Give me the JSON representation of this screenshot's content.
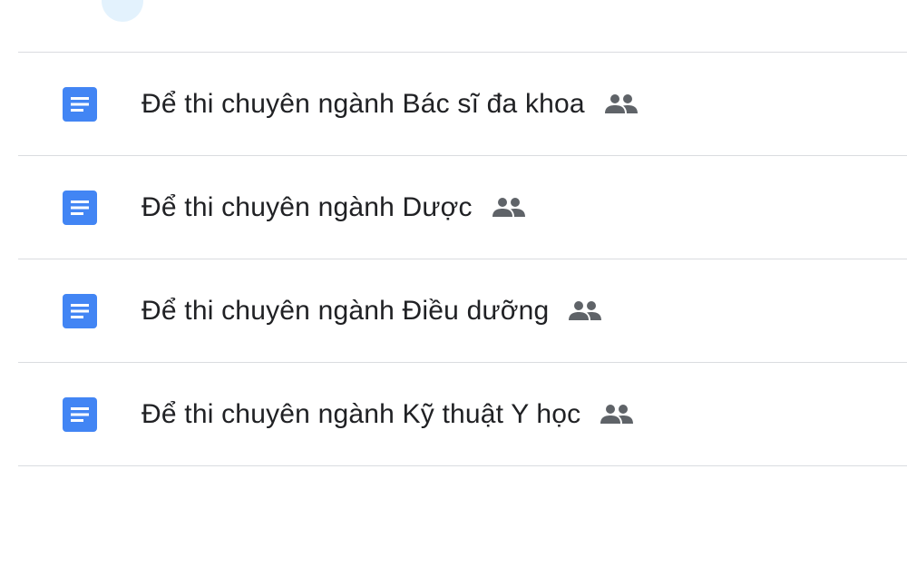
{
  "colors": {
    "doc_icon": "#4285f4",
    "shared_icon": "#5f6368",
    "text": "#202124",
    "divider": "#dadce0"
  },
  "file_list": {
    "items": [
      {
        "name": "Để thi chuyên ngành Bác sĩ đa khoa",
        "icon": "google-docs-icon",
        "shared": true
      },
      {
        "name": "Để thi chuyên ngành Dược",
        "icon": "google-docs-icon",
        "shared": true
      },
      {
        "name": "Để thi chuyên ngành Điều dưỡng",
        "icon": "google-docs-icon",
        "shared": true
      },
      {
        "name": "Để thi chuyên ngành Kỹ thuật Y học",
        "icon": "google-docs-icon",
        "shared": true
      }
    ]
  }
}
